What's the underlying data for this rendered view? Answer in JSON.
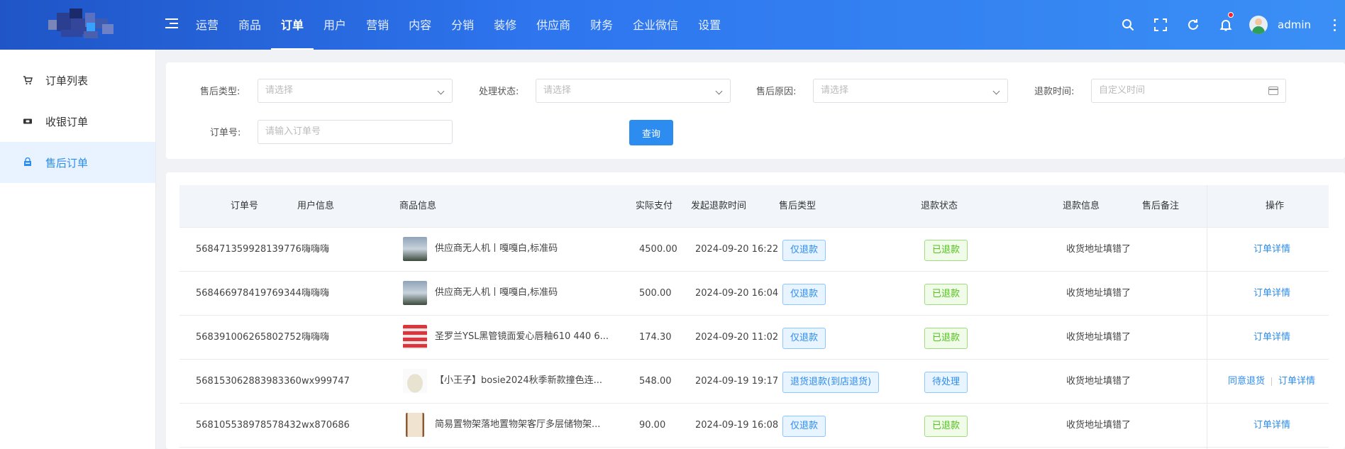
{
  "topnav": {
    "menu": [
      "运营",
      "商品",
      "订单",
      "用户",
      "营销",
      "内容",
      "分销",
      "装修",
      "供应商",
      "财务",
      "企业微信",
      "设置"
    ],
    "active_index": 2,
    "username": "admin",
    "icons": [
      "search-icon",
      "fullscreen-icon",
      "refresh-icon",
      "bell-icon"
    ]
  },
  "sidebar": {
    "items": [
      {
        "label": "订单列表",
        "icon": "cart-icon"
      },
      {
        "label": "收银订单",
        "icon": "cashier-icon"
      },
      {
        "label": "售后订单",
        "icon": "after-sales-icon"
      }
    ],
    "active_index": 2
  },
  "filters": {
    "after_sale_type": {
      "label": "售后类型:",
      "placeholder": "请选择"
    },
    "status": {
      "label": "处理状态:",
      "placeholder": "请选择"
    },
    "reason": {
      "label": "售后原因:",
      "placeholder": "请选择"
    },
    "refund_time": {
      "label": "退款时间:",
      "placeholder": "自定义时间"
    },
    "order_no": {
      "label": "订单号:",
      "placeholder": "请输入订单号"
    },
    "query_label": "查询"
  },
  "table": {
    "columns": [
      "订单号",
      "用户信息",
      "商品信息",
      "实际支付",
      "发起退款时间",
      "售后类型",
      "退款状态",
      "退款信息",
      "售后备注",
      "操作"
    ],
    "rows": [
      {
        "order_no": "568471359928139776",
        "user": "嗨嗨嗨",
        "product": "供应商无人机丨嘎嘎白,标准码",
        "paid": "4500.00",
        "time": "2024-09-20 16:22",
        "type": "仅退款",
        "status": "已退款",
        "status_color": "green",
        "info": "收货地址填错了",
        "actions": [
          "订单详情"
        ]
      },
      {
        "order_no": "568466978419769344",
        "user": "嗨嗨嗨",
        "product": "供应商无人机丨嘎嘎白,标准码",
        "paid": "500.00",
        "time": "2024-09-20 16:04",
        "type": "仅退款",
        "status": "已退款",
        "status_color": "green",
        "info": "收货地址填错了",
        "actions": [
          "订单详情"
        ]
      },
      {
        "order_no": "568391006265802752",
        "user": "嗨嗨嗨",
        "product": "圣罗兰YSL黑管镜面爱心唇釉610 440 6...",
        "paid": "174.30",
        "time": "2024-09-20 11:02",
        "type": "仅退款",
        "status": "已退款",
        "status_color": "green",
        "info": "收货地址填错了",
        "actions": [
          "订单详情"
        ]
      },
      {
        "order_no": "568153062883983360",
        "user": "wx999747",
        "product": "【小王子】bosie2024秋季新款撞色连...",
        "paid": "548.00",
        "time": "2024-09-19 19:17",
        "type": "退货退款(到店退货)",
        "status": "待处理",
        "status_color": "blue",
        "info": "收货地址填错了",
        "actions": [
          "同意退货",
          "订单详情"
        ]
      },
      {
        "order_no": "568105538978578432",
        "user": "wx870686",
        "product": "简易置物架落地置物架客厅多层储物架...",
        "paid": "90.00",
        "time": "2024-09-19 16:08",
        "type": "仅退款",
        "status": "已退款",
        "status_color": "green",
        "info": "收货地址填错了",
        "actions": [
          "订单详情"
        ]
      }
    ]
  },
  "colors": {
    "primary": "#2d8cf0",
    "success": "#52c41a",
    "nav_start": "#1f55c7",
    "nav_end": "#3a8ff5"
  }
}
